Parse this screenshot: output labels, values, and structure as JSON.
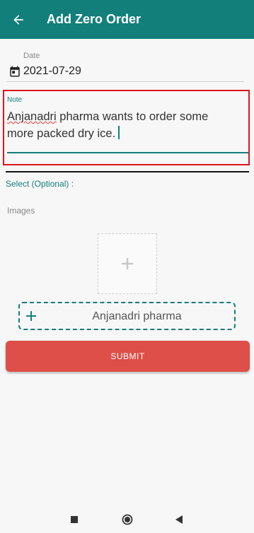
{
  "appbar": {
    "title": "Add Zero Order",
    "back_icon": "arrow-left-icon",
    "color": "#137f7b"
  },
  "date_field": {
    "label": "Date",
    "value": "2021-07-29",
    "icon": "calendar-icon"
  },
  "note_field": {
    "label": "Note",
    "value_misspelled": "Anjanadri",
    "value_rest": " pharma wants to order some more packed dry ice.",
    "highlight_color": "#e0151d"
  },
  "select_section": {
    "label": "Select (Optional) :"
  },
  "images_section": {
    "label": "Images",
    "add_icon": "plus-icon"
  },
  "customer_button": {
    "label": "Anjanadri pharma",
    "icon": "plus-icon"
  },
  "submit_button": {
    "label": "SUBMIT",
    "color": "#dd4f48"
  },
  "system_nav": {
    "recents_icon": "square-icon",
    "home_icon": "circle-icon",
    "back_icon": "triangle-back-icon"
  }
}
